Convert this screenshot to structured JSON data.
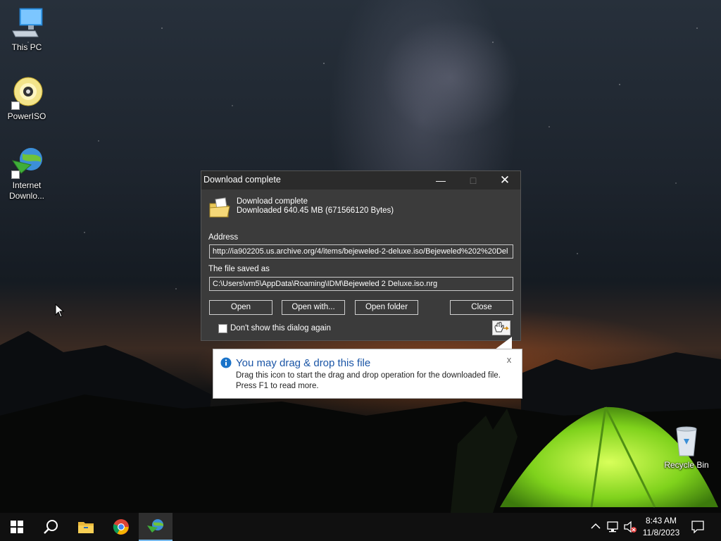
{
  "desktop": {
    "icons": [
      {
        "label": "This PC"
      },
      {
        "label": "PowerISO"
      },
      {
        "label": "Internet Downlo..."
      },
      {
        "label": "Recycle Bin"
      }
    ]
  },
  "dialog": {
    "title": "Download complete",
    "heading": "Download complete",
    "summary": "Downloaded 640.45  MB (671566120 Bytes)",
    "address_label": "Address",
    "address_value": "http://ia902205.us.archive.org/4/items/bejeweled-2-deluxe.iso/Bejeweled%202%20Del",
    "saved_label": "The file saved as",
    "saved_value": "C:\\Users\\vm5\\AppData\\Roaming\\IDM\\Bejeweled 2 Deluxe.iso.nrg",
    "buttons": {
      "open": "Open",
      "open_with": "Open with...",
      "open_folder": "Open folder",
      "close": "Close"
    },
    "dont_show_label": "Don't show this dialog again",
    "dont_show_checked": false
  },
  "balloon": {
    "title": "You may drag & drop this file",
    "body_line1": "Drag this icon to start the drag and drop operation for the downloaded file.",
    "body_line2": "Press F1 to read more.",
    "close_glyph": "x"
  },
  "taskbar": {
    "time": "8:43 AM",
    "date": "11/8/2023"
  },
  "colors": {
    "dialog_bg": "#3b3b3b",
    "titlebar_bg": "#2b2b2b",
    "info_blue": "#1a73c9",
    "balloon_title": "#1a55a6",
    "taskbar_bg": "#101010"
  }
}
